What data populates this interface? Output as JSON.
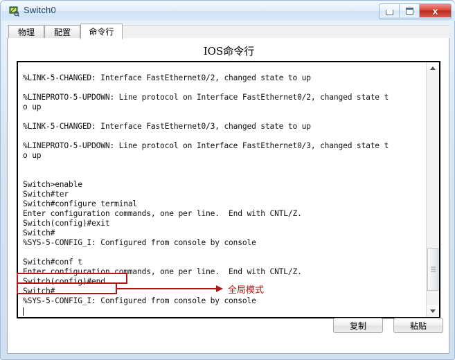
{
  "window": {
    "title": "Switch0",
    "icon": "switch-device-icon",
    "controls": {
      "minimize": "minimize-icon",
      "maximize": "maximize-icon",
      "close": "x"
    }
  },
  "tabs": [
    {
      "label": "物理",
      "active": false
    },
    {
      "label": "配置",
      "active": false
    },
    {
      "label": "命令行",
      "active": true
    }
  ],
  "panel": {
    "heading": "IOS命令行"
  },
  "console": {
    "text": "%LINK-5-CHANGED: Interface FastEthernet0/2, changed state to up\n\n%LINEPROTO-5-UPDOWN: Line protocol on Interface FastEthernet0/2, changed state t\no up\n\n%LINK-5-CHANGED: Interface FastEthernet0/3, changed state to up\n\n%LINEPROTO-5-UPDOWN: Line protocol on Interface FastEthernet0/3, changed state t\no up\n\n\nSwitch>enable\nSwitch#ter\nSwitch#configure terminal\nEnter configuration commands, one per line.  End with CNTL/Z.\nSwitch(config)#exit\nSwitch#\n%SYS-5-CONFIG_I: Configured from console by console\n\nSwitch#conf t\nEnter configuration commands, one per line.  End with CNTL/Z.\nSwitch(config)#end\nSwitch#\n%SYS-5-CONFIG_I: Configured from console by console",
    "lines": [
      "%LINK-5-CHANGED: Interface FastEthernet0/2, changed state to up",
      "",
      "%LINEPROTO-5-UPDOWN: Line protocol on Interface FastEthernet0/2, changed state t",
      "o up",
      "",
      "%LINK-5-CHANGED: Interface FastEthernet0/3, changed state to up",
      "",
      "%LINEPROTO-5-UPDOWN: Line protocol on Interface FastEthernet0/3, changed state t",
      "o up",
      "",
      "",
      "Switch>enable",
      "Switch#ter",
      "Switch#configure terminal",
      "Enter configuration commands, one per line.  End with CNTL/Z.",
      "Switch(config)#exit",
      "Switch#",
      "%SYS-5-CONFIG_I: Configured from console by console",
      "",
      "Switch#conf t",
      "Enter configuration commands, one per line.  End with CNTL/Z.",
      "Switch(config)#end",
      "Switch#",
      "%SYS-5-CONFIG_I: Configured from console by console"
    ]
  },
  "annotations": {
    "color": "#b01616",
    "label": "全局模式",
    "highlighted": [
      "Switch(config)#end",
      "Switch#"
    ]
  },
  "footer": {
    "copy_label": "复制",
    "paste_label": "粘贴"
  }
}
